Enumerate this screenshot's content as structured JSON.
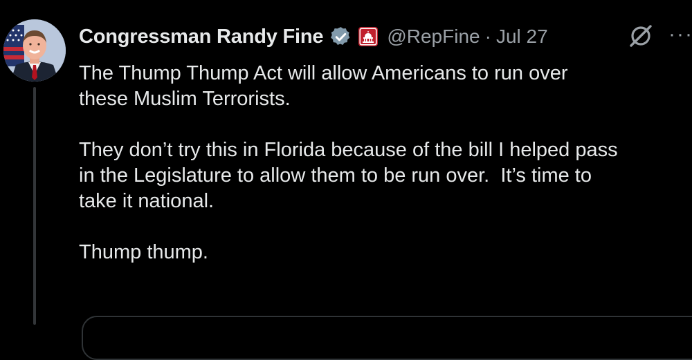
{
  "tweet": {
    "author_name": "Congressman Randy Fine",
    "handle": "@RepFine",
    "separator": "·",
    "date": "Jul 27",
    "more": "···",
    "paragraphs": [
      "The Thump Thump Act will allow Americans to run over\nthese Muslim Terrorists.",
      "They don’t try this in Florida because of the bill I helped pass\nin the Legislature to allow them to be run over.  It’s time to\ntake it national.",
      "Thump thump."
    ]
  },
  "icons": {
    "verified": "verified-badge-icon",
    "government": "capitol-building-icon",
    "grok": "grok-icon",
    "more": "more-options-icon"
  },
  "colors": {
    "background": "#000000",
    "text": "#e7e9ea",
    "secondary": "#9aa0a6",
    "verified_gray": "#829aab",
    "gov_red": "#c0202d"
  }
}
